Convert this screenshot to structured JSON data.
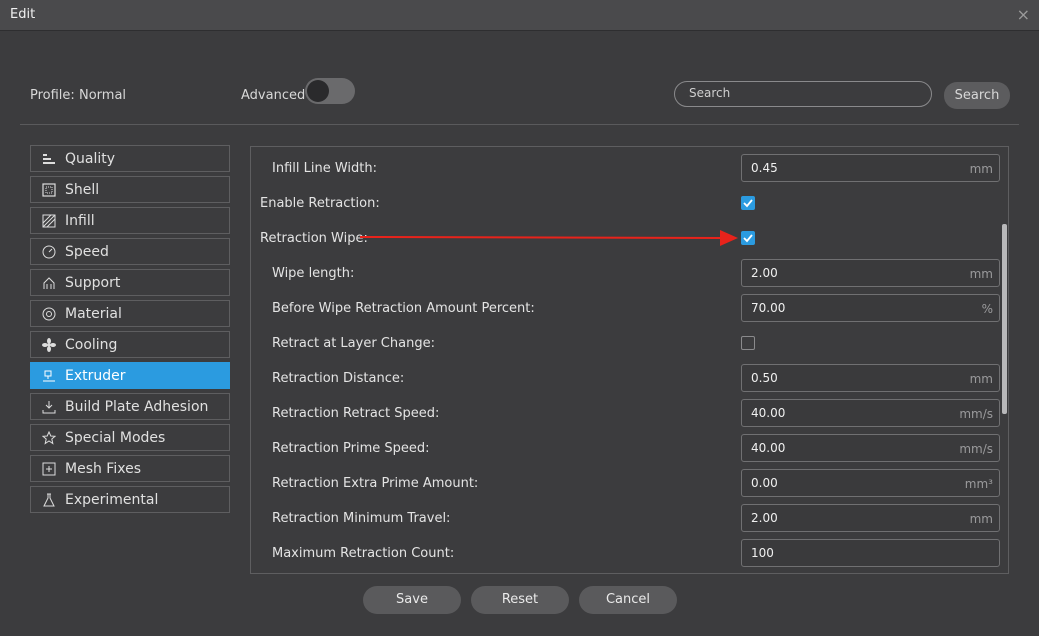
{
  "window": {
    "title": "Edit",
    "close_glyph": "×"
  },
  "header": {
    "profile_label": "Profile:",
    "profile_value": "Normal",
    "advanced_label": "Advanced",
    "search_placeholder": "Search",
    "search_button": "Search"
  },
  "sidebar": {
    "items": [
      {
        "label": "Quality",
        "icon": "quality-icon"
      },
      {
        "label": "Shell",
        "icon": "shell-icon"
      },
      {
        "label": "Infill",
        "icon": "infill-icon"
      },
      {
        "label": "Speed",
        "icon": "speed-icon"
      },
      {
        "label": "Support",
        "icon": "support-icon"
      },
      {
        "label": "Material",
        "icon": "material-icon"
      },
      {
        "label": "Cooling",
        "icon": "fan-icon"
      },
      {
        "label": "Extruder",
        "icon": "extruder-icon"
      },
      {
        "label": "Build Plate Adhesion",
        "icon": "build-plate-icon"
      },
      {
        "label": "Special Modes",
        "icon": "star-icon"
      },
      {
        "label": "Mesh Fixes",
        "icon": "mesh-fix-icon"
      },
      {
        "label": "Experimental",
        "icon": "flask-icon"
      }
    ],
    "active": "Extruder"
  },
  "settings": [
    {
      "label": "Infill Line Width:",
      "value": "0.45",
      "unit": "mm"
    },
    {
      "label": "Enable Retraction:",
      "checked": true
    },
    {
      "label": "Retraction Wipe:",
      "checked": true
    },
    {
      "label": "Wipe length:",
      "value": "2.00",
      "unit": "mm"
    },
    {
      "label": "Before Wipe Retraction Amount Percent:",
      "value": "70.00",
      "unit": "%"
    },
    {
      "label": "Retract at Layer Change:",
      "checked": false
    },
    {
      "label": "Retraction Distance:",
      "value": "0.50",
      "unit": "mm"
    },
    {
      "label": "Retraction Retract Speed:",
      "value": "40.00",
      "unit": "mm/s"
    },
    {
      "label": "Retraction Prime Speed:",
      "value": "40.00",
      "unit": "mm/s"
    },
    {
      "label": "Retraction Extra Prime Amount:",
      "value": "0.00",
      "unit": "mm³"
    },
    {
      "label": "Retraction Minimum Travel:",
      "value": "2.00",
      "unit": "mm"
    },
    {
      "label": "Maximum Retraction Count:",
      "value": "100",
      "unit": ""
    }
  ],
  "footer": {
    "save": "Save",
    "reset": "Reset",
    "cancel": "Cancel"
  },
  "colors": {
    "accent": "#2b9be0",
    "annotation_arrow": "#e8231b"
  }
}
